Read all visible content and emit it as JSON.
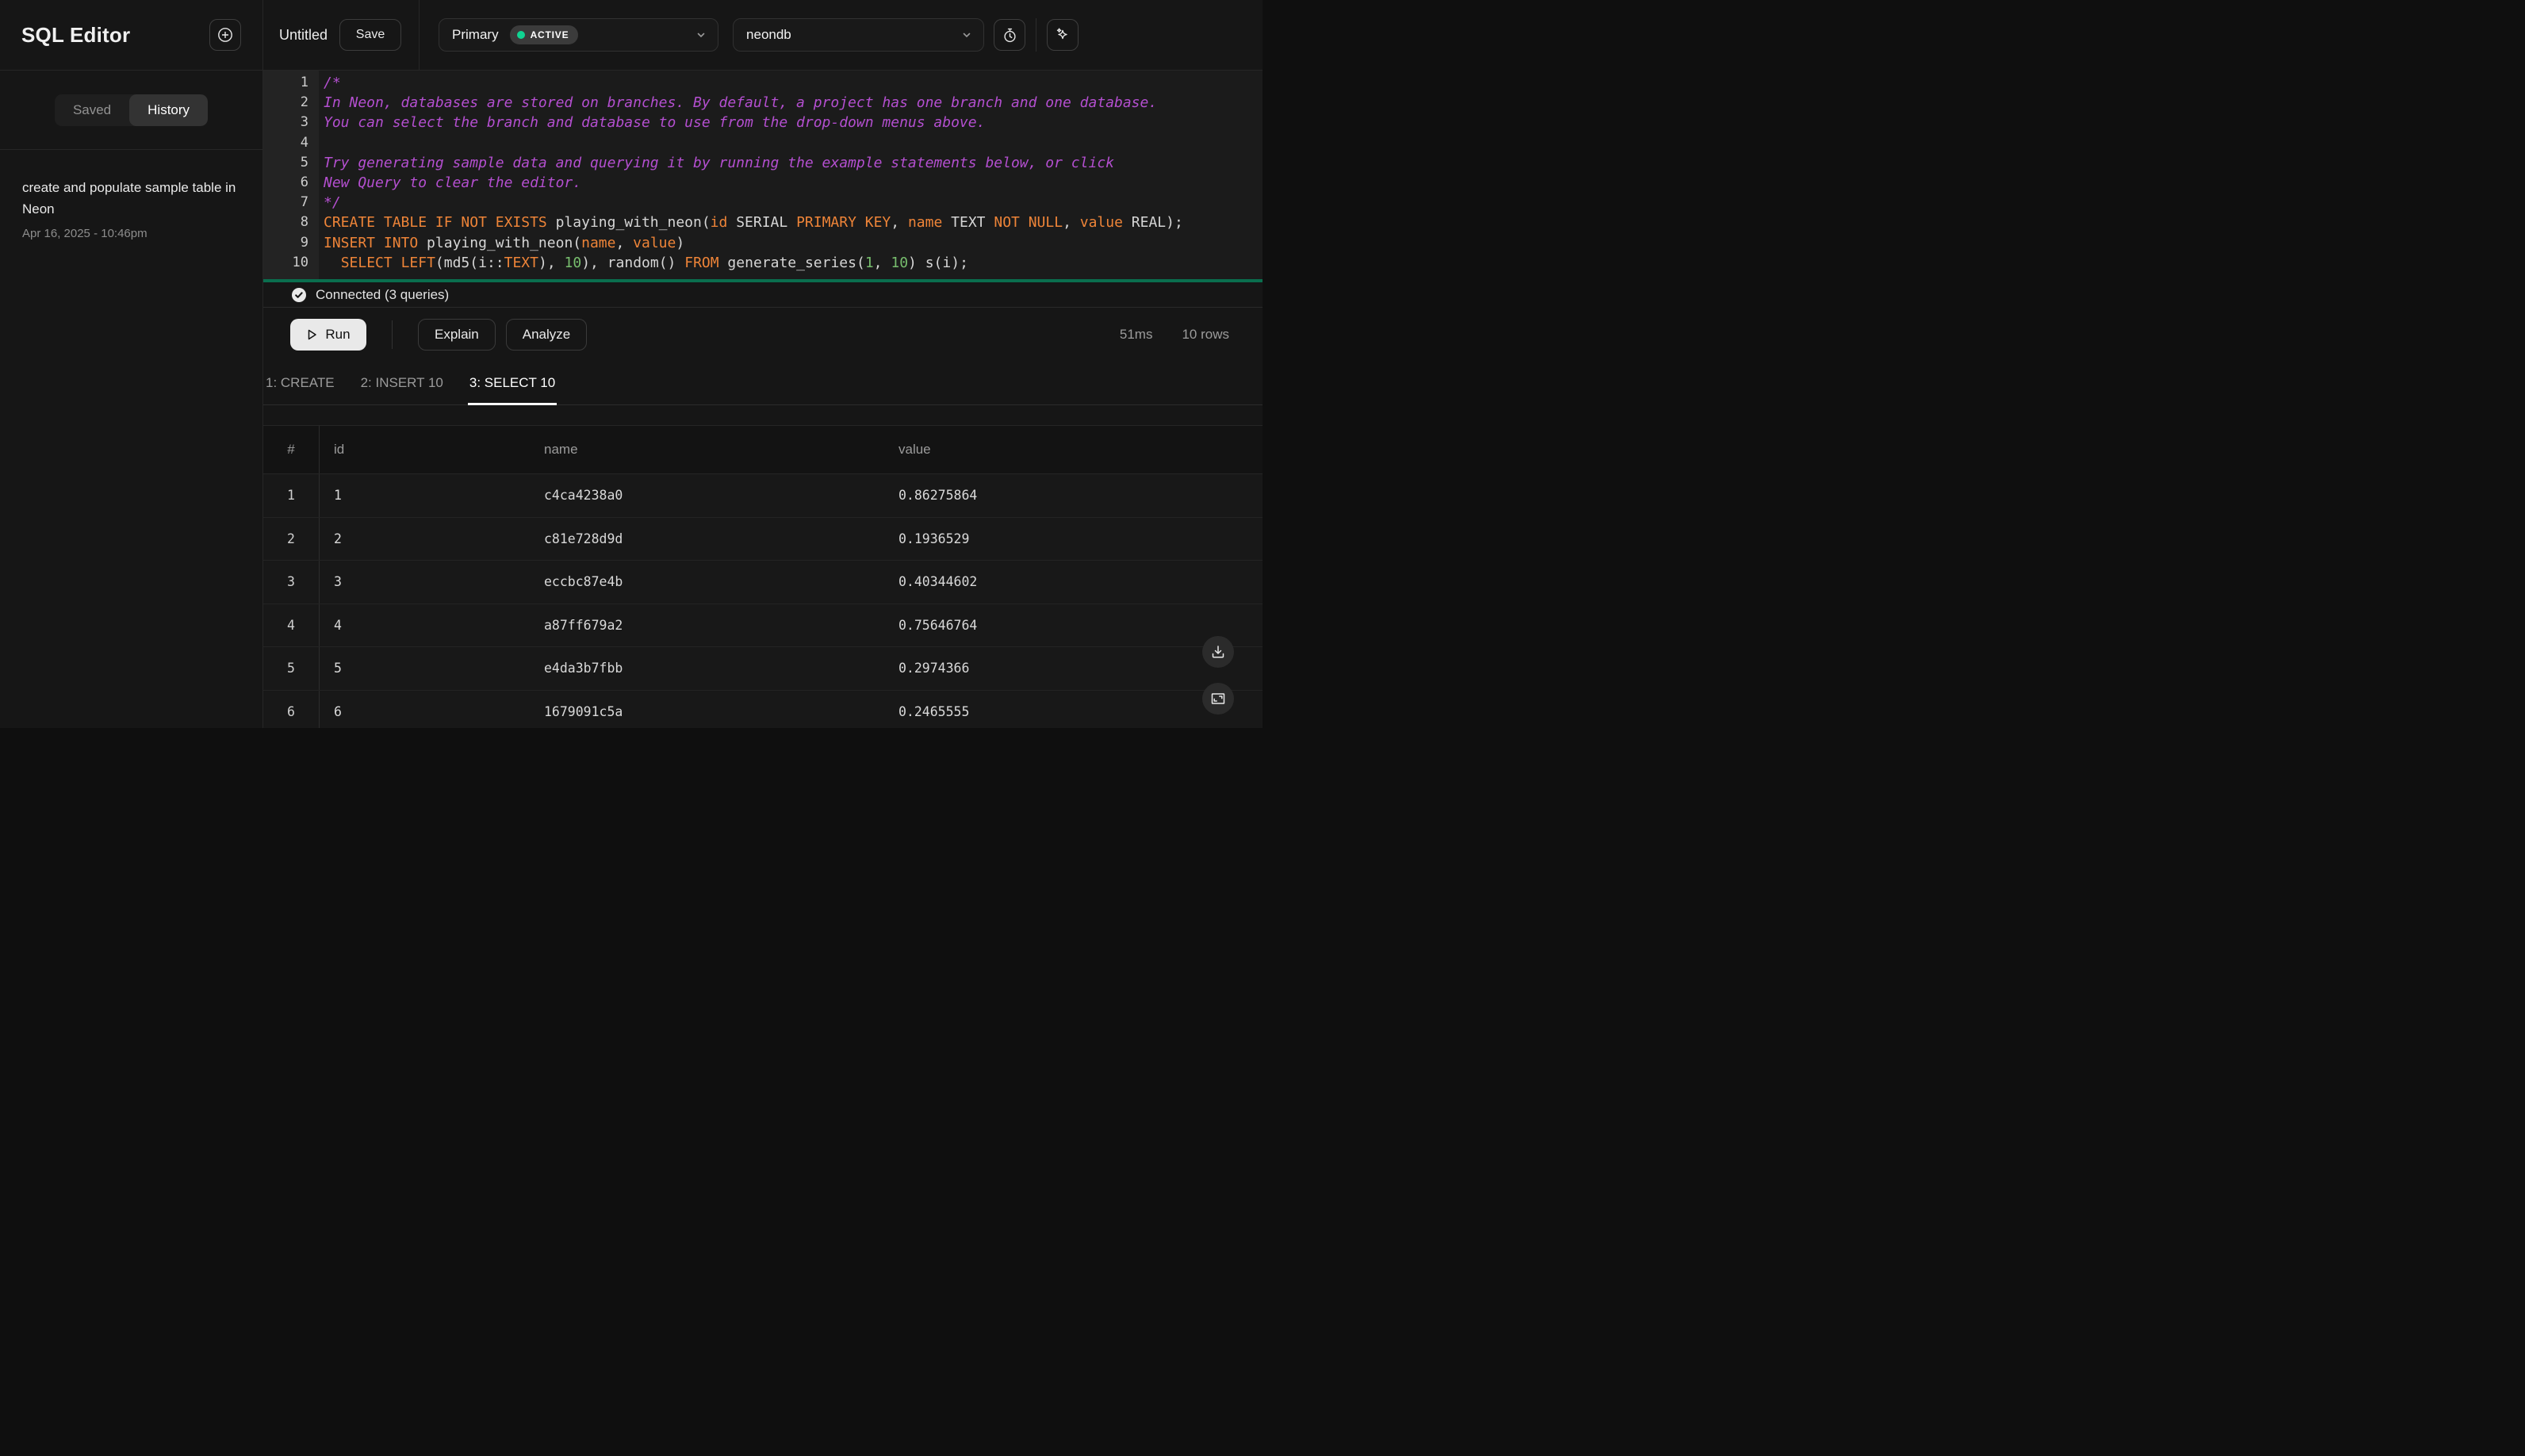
{
  "colors": {
    "status_active_green": "#0fd492",
    "editor_divider_green": "#0a6e4e",
    "syntax_keyword_orange": "#ee8438",
    "syntax_comment_purple": "#b44fd0",
    "syntax_number_green": "#77bd6d",
    "run_button_bg": "#e9e9e9"
  },
  "sidebar": {
    "title": "SQL Editor",
    "tabs": {
      "saved": "Saved",
      "history": "History",
      "active": "History"
    },
    "history_items": [
      {
        "title": "create and populate sample table in Neon",
        "timestamp": "Apr 16, 2025 - 10:46pm"
      }
    ]
  },
  "topbar": {
    "query_name": "Untitled",
    "save_label": "Save",
    "branch_select": {
      "value": "Primary",
      "status_badge": "ACTIVE"
    },
    "database_select": {
      "value": "neondb"
    }
  },
  "editor": {
    "lines": [
      [
        [
          "c",
          "/*"
        ]
      ],
      [
        [
          "c",
          "In Neon, databases are stored on branches. By default, a project has one branch and one database."
        ]
      ],
      [
        [
          "c",
          "You can select the branch and database to use from the drop-down menus above."
        ]
      ],
      [],
      [
        [
          "c",
          "Try generating sample data and querying it by running the example statements below, or click"
        ]
      ],
      [
        [
          "c",
          "New Query to clear the editor."
        ]
      ],
      [
        [
          "c",
          "*/"
        ]
      ],
      [
        [
          "k",
          "CREATE TABLE IF NOT EXISTS"
        ],
        [
          "p",
          " playing_with_neon("
        ],
        [
          "k",
          "id"
        ],
        [
          "p",
          " SERIAL "
        ],
        [
          "k",
          "PRIMARY KEY"
        ],
        [
          "p",
          ", "
        ],
        [
          "k",
          "name"
        ],
        [
          "p",
          " TEXT "
        ],
        [
          "k",
          "NOT NULL"
        ],
        [
          "p",
          ", "
        ],
        [
          "k",
          "value"
        ],
        [
          "p",
          " REAL);"
        ]
      ],
      [
        [
          "k",
          "INSERT INTO"
        ],
        [
          "p",
          " playing_with_neon("
        ],
        [
          "k",
          "name"
        ],
        [
          "p",
          ", "
        ],
        [
          "k",
          "value"
        ],
        [
          "p",
          ")"
        ]
      ],
      [
        [
          "p",
          "  "
        ],
        [
          "k",
          "SELECT"
        ],
        [
          "p",
          " "
        ],
        [
          "k",
          "LEFT"
        ],
        [
          "p",
          "(md5(i::"
        ],
        [
          "k",
          "TEXT"
        ],
        [
          "p",
          "), "
        ],
        [
          "n",
          "10"
        ],
        [
          "p",
          "), random() "
        ],
        [
          "k",
          "FROM"
        ],
        [
          "p",
          " generate_series("
        ],
        [
          "n",
          "1"
        ],
        [
          "p",
          ", "
        ],
        [
          "n",
          "10"
        ],
        [
          "p",
          ") s(i);"
        ]
      ]
    ]
  },
  "status_bar": {
    "connected_label": "Connected (3 queries)"
  },
  "actions": {
    "run_label": "Run",
    "explain_label": "Explain",
    "analyze_label": "Analyze",
    "duration": "51ms",
    "row_count": "10 rows"
  },
  "result_tabs": [
    {
      "label": "1: CREATE",
      "active": false
    },
    {
      "label": "2: INSERT 10",
      "active": false
    },
    {
      "label": "3: SELECT 10",
      "active": true
    }
  ],
  "results_table": {
    "columns": [
      "#",
      "id",
      "name",
      "value"
    ],
    "rows": [
      [
        "1",
        "1",
        "c4ca4238a0",
        "0.86275864"
      ],
      [
        "2",
        "2",
        "c81e728d9d",
        "0.1936529"
      ],
      [
        "3",
        "3",
        "eccbc87e4b",
        "0.40344602"
      ],
      [
        "4",
        "4",
        "a87ff679a2",
        "0.75646764"
      ],
      [
        "5",
        "5",
        "e4da3b7fbb",
        "0.2974366"
      ],
      [
        "6",
        "6",
        "1679091c5a",
        "0.2465555"
      ]
    ]
  }
}
